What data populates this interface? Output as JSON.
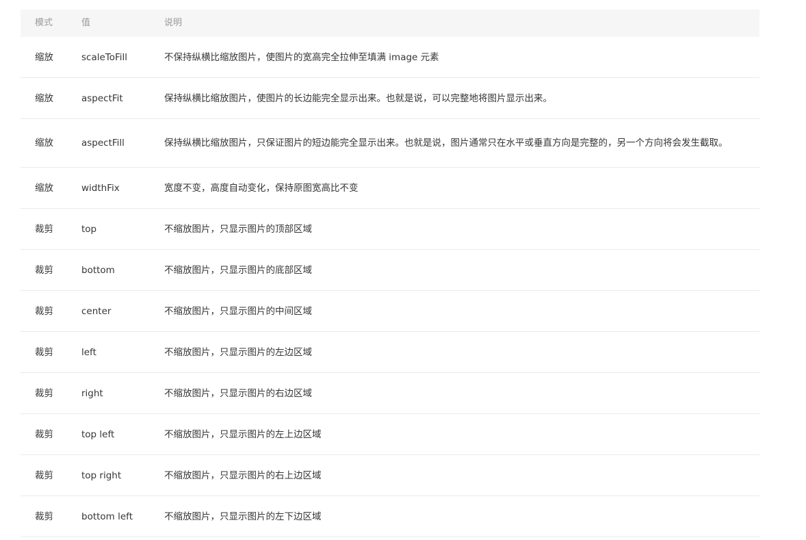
{
  "table": {
    "headers": {
      "mode": "模式",
      "value": "值",
      "desc": "说明"
    },
    "rows": [
      {
        "mode": "缩放",
        "value": "scaleToFill",
        "desc": "不保持纵横比缩放图片，使图片的宽高完全拉伸至填满 image 元素"
      },
      {
        "mode": "缩放",
        "value": "aspectFit",
        "desc": "保持纵横比缩放图片，使图片的长边能完全显示出来。也就是说，可以完整地将图片显示出来。"
      },
      {
        "mode": "缩放",
        "value": "aspectFill",
        "desc": "保持纵横比缩放图片，只保证图片的短边能完全显示出来。也就是说，图片通常只在水平或垂直方向是完整的，另一个方向将会发生截取。"
      },
      {
        "mode": "缩放",
        "value": "widthFix",
        "desc": "宽度不变，高度自动变化，保持原图宽高比不变"
      },
      {
        "mode": "裁剪",
        "value": "top",
        "desc": "不缩放图片，只显示图片的顶部区域"
      },
      {
        "mode": "裁剪",
        "value": "bottom",
        "desc": "不缩放图片，只显示图片的底部区域"
      },
      {
        "mode": "裁剪",
        "value": "center",
        "desc": "不缩放图片，只显示图片的中间区域"
      },
      {
        "mode": "裁剪",
        "value": "left",
        "desc": "不缩放图片，只显示图片的左边区域"
      },
      {
        "mode": "裁剪",
        "value": "right",
        "desc": "不缩放图片，只显示图片的右边区域"
      },
      {
        "mode": "裁剪",
        "value": "top left",
        "desc": "不缩放图片，只显示图片的左上边区域"
      },
      {
        "mode": "裁剪",
        "value": "top right",
        "desc": "不缩放图片，只显示图片的右上边区域"
      },
      {
        "mode": "裁剪",
        "value": "bottom left",
        "desc": "不缩放图片，只显示图片的左下边区域"
      }
    ]
  }
}
